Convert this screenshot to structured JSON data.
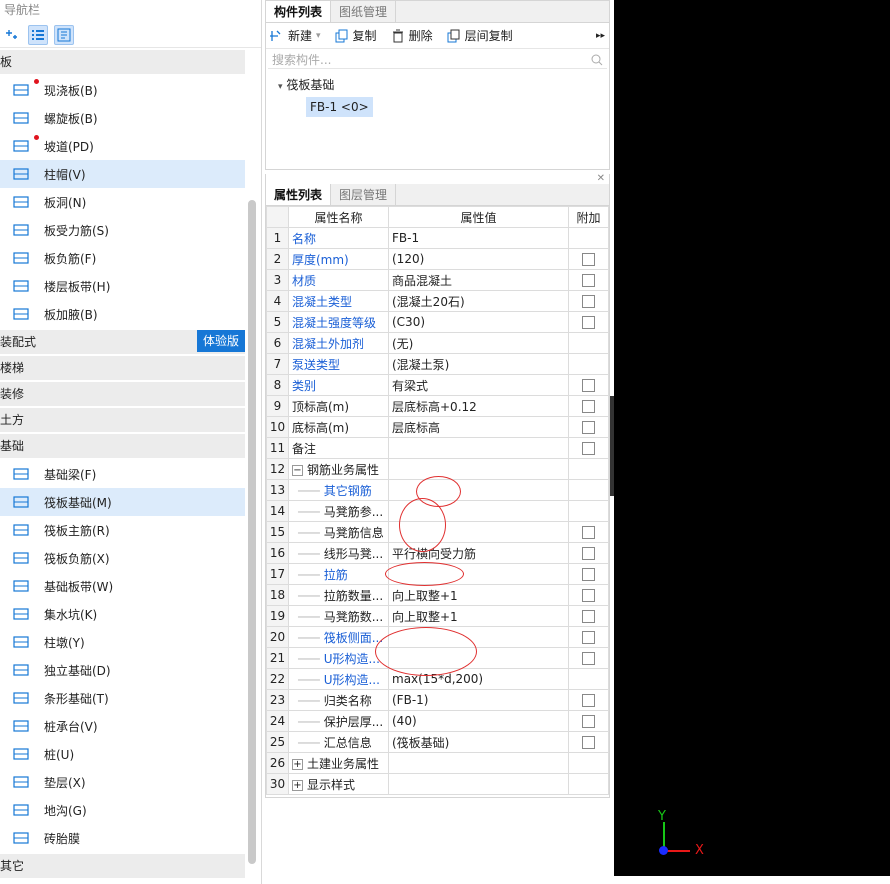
{
  "nav": {
    "title": "导航栏",
    "cat_ban": "板",
    "ban_items": [
      {
        "label": "现浇板(B)",
        "icon": "cast-slab-icon",
        "dot": true
      },
      {
        "label": "螺旋板(B)",
        "icon": "spiral-slab-icon"
      },
      {
        "label": "坡道(PD)",
        "icon": "ramp-icon",
        "dot": true
      },
      {
        "label": "柱帽(V)",
        "icon": "column-cap-icon",
        "sel": true
      },
      {
        "label": "板洞(N)",
        "icon": "slab-hole-icon"
      },
      {
        "label": "板受力筋(S)",
        "icon": "slab-stress-bar-icon"
      },
      {
        "label": "板负筋(F)",
        "icon": "slab-neg-bar-icon"
      },
      {
        "label": "楼层板带(H)",
        "icon": "floor-strip-icon"
      },
      {
        "label": "板加腋(B)",
        "icon": "slab-haunch-icon"
      }
    ],
    "cat_assembly": "装配式",
    "badge": "体验版",
    "cat_stairs": "楼梯",
    "cat_decor": "装修",
    "cat_earth": "土方",
    "cat_found": "基础",
    "found_items": [
      {
        "label": "基础梁(F)"
      },
      {
        "label": "筏板基础(M)",
        "sel": true
      },
      {
        "label": "筏板主筋(R)"
      },
      {
        "label": "筏板负筋(X)"
      },
      {
        "label": "基础板带(W)"
      },
      {
        "label": "集水坑(K)"
      },
      {
        "label": "柱墩(Y)"
      },
      {
        "label": "独立基础(D)"
      },
      {
        "label": "条形基础(T)"
      },
      {
        "label": "桩承台(V)"
      },
      {
        "label": "桩(U)"
      },
      {
        "label": "垫层(X)"
      },
      {
        "label": "地沟(G)"
      },
      {
        "label": "砖胎膜"
      }
    ],
    "cat_other": "其它"
  },
  "comp": {
    "tab1": "构件列表",
    "tab2": "图纸管理",
    "new": "新建",
    "copy": "复制",
    "delete": "删除",
    "floor_copy": "层间复制",
    "search_placeholder": "搜索构件...",
    "tree_root": "筏板基础",
    "tree_child": "FB-1 <0>"
  },
  "prop": {
    "tab1": "属性列表",
    "tab2": "图层管理",
    "h_name": "属性名称",
    "h_value": "属性值",
    "h_add": "附加",
    "rows": [
      {
        "n": "1",
        "k": "名称",
        "v": "FB-1",
        "blue": true,
        "cb": false
      },
      {
        "n": "2",
        "k": "厚度(mm)",
        "v": "(120)",
        "blue": true,
        "cb": true
      },
      {
        "n": "3",
        "k": "材质",
        "v": "商品混凝土",
        "blue": true,
        "cb": true
      },
      {
        "n": "4",
        "k": "混凝土类型",
        "v": "(混凝土20石)",
        "blue": true,
        "cb": true
      },
      {
        "n": "5",
        "k": "混凝土强度等级",
        "v": "(C30)",
        "blue": true,
        "cb": true
      },
      {
        "n": "6",
        "k": "混凝土外加剂",
        "v": "(无)",
        "blue": true,
        "cb": false
      },
      {
        "n": "7",
        "k": "泵送类型",
        "v": "(混凝土泵)",
        "blue": true,
        "cb": false
      },
      {
        "n": "8",
        "k": "类别",
        "v": "有梁式",
        "blue": true,
        "cb": true
      },
      {
        "n": "9",
        "k": "顶标高(m)",
        "v": "层底标高+0.12",
        "cb": true
      },
      {
        "n": "10",
        "k": "底标高(m)",
        "v": "层底标高",
        "cb": true
      },
      {
        "n": "11",
        "k": "备注",
        "v": "",
        "cb": true
      },
      {
        "n": "12",
        "k": "钢筋业务属性",
        "v": "",
        "group": "−",
        "cb": false
      },
      {
        "n": "13",
        "k": "其它钢筋",
        "v": "",
        "blue": true,
        "sub": true,
        "cb": false
      },
      {
        "n": "14",
        "k": "马凳筋参...",
        "v": "",
        "sub": true,
        "cb": false
      },
      {
        "n": "15",
        "k": "马凳筋信息",
        "v": "",
        "sub": true,
        "cb": true
      },
      {
        "n": "16",
        "k": "线形马凳...",
        "v": "平行横向受力筋",
        "sub": true,
        "cb": true
      },
      {
        "n": "17",
        "k": "拉筋",
        "v": "",
        "blue": true,
        "sub": true,
        "cb": true
      },
      {
        "n": "18",
        "k": "拉筋数量...",
        "v": "向上取整+1",
        "sub": true,
        "cb": true
      },
      {
        "n": "19",
        "k": "马凳筋数...",
        "v": "向上取整+1",
        "sub": true,
        "cb": true
      },
      {
        "n": "20",
        "k": "筏板侧面...",
        "v": "",
        "blue": true,
        "sub": true,
        "cb": true
      },
      {
        "n": "21",
        "k": "U形构造...",
        "v": "",
        "blue": true,
        "sub": true,
        "cb": true
      },
      {
        "n": "22",
        "k": "U形构造...",
        "v": "max(15*d,200)",
        "blue": true,
        "sub": true,
        "cb": false
      },
      {
        "n": "23",
        "k": "归类名称",
        "v": "(FB-1)",
        "sub": true,
        "cb": true
      },
      {
        "n": "24",
        "k": "保护层厚...",
        "v": "(40)",
        "sub": true,
        "cb": true
      },
      {
        "n": "25",
        "k": "汇总信息",
        "v": "(筏板基础)",
        "sub": true,
        "cb": true
      },
      {
        "n": "26",
        "k": "土建业务属性",
        "v": "",
        "group": "+",
        "cb": false
      },
      {
        "n": "30",
        "k": "显示样式",
        "v": "",
        "group": "+",
        "cb": false
      }
    ]
  },
  "axis": {
    "y": "Y",
    "x": "X"
  },
  "colors": {
    "accent": "#1677d6",
    "selected": "#dcebfb",
    "link": "#1a5fd6",
    "annotation": "#e03030"
  }
}
